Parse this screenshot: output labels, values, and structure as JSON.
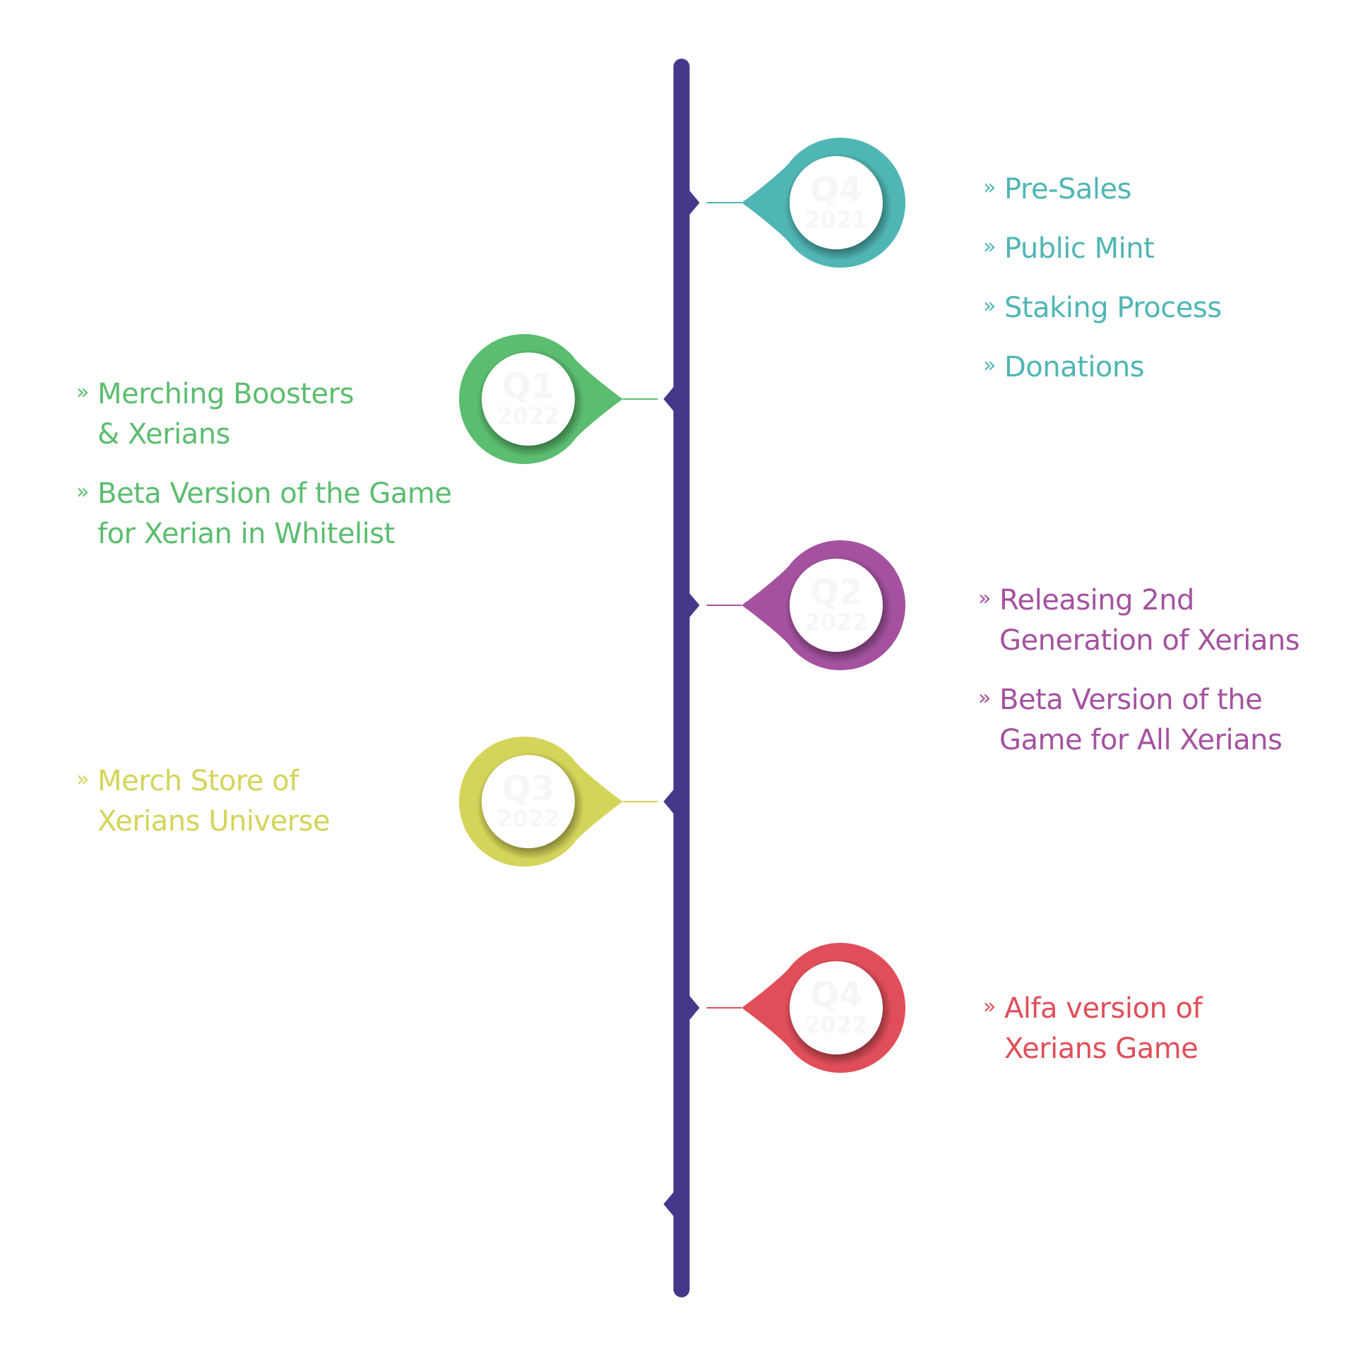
{
  "timeline": {
    "spine_color": "#45388a",
    "milestones": [
      {
        "id": "q4-2021",
        "quarter": "Q4",
        "year": "2021",
        "side": "right",
        "color": "#4fb6b4",
        "items": [
          {
            "lines": [
              "Pre-Sales"
            ]
          },
          {
            "lines": [
              "Public Mint"
            ]
          },
          {
            "lines": [
              "Staking Process"
            ]
          },
          {
            "lines": [
              "Donations"
            ]
          }
        ]
      },
      {
        "id": "q1-2022",
        "quarter": "Q1",
        "year": "2022",
        "side": "left",
        "color": "#5bbd6f",
        "items": [
          {
            "lines": [
              "Merching Boosters",
              "& Xerians"
            ]
          },
          {
            "lines": [
              "Beta Version of the Game",
              "for Xerian in Whitelist"
            ]
          }
        ]
      },
      {
        "id": "q2-2022",
        "quarter": "Q2",
        "year": "2022",
        "side": "right",
        "color": "#a4529f",
        "items": [
          {
            "lines": [
              "Releasing 2nd",
              "Generation of Xerians"
            ]
          },
          {
            "lines": [
              "Beta Version of the",
              "Game for All Xerians"
            ]
          }
        ]
      },
      {
        "id": "q3-2022",
        "quarter": "Q3",
        "year": "2022",
        "side": "left",
        "color": "#d4d45a",
        "items": [
          {
            "lines": [
              "Merch Store of",
              "Xerians Universe"
            ]
          }
        ]
      },
      {
        "id": "q4-2022",
        "quarter": "Q4",
        "year": "2022",
        "side": "right",
        "color": "#e04e5a",
        "items": [
          {
            "lines": [
              "Alfa version of",
              "Xerians Game"
            ]
          }
        ]
      }
    ],
    "bullet_glyph": "»"
  }
}
